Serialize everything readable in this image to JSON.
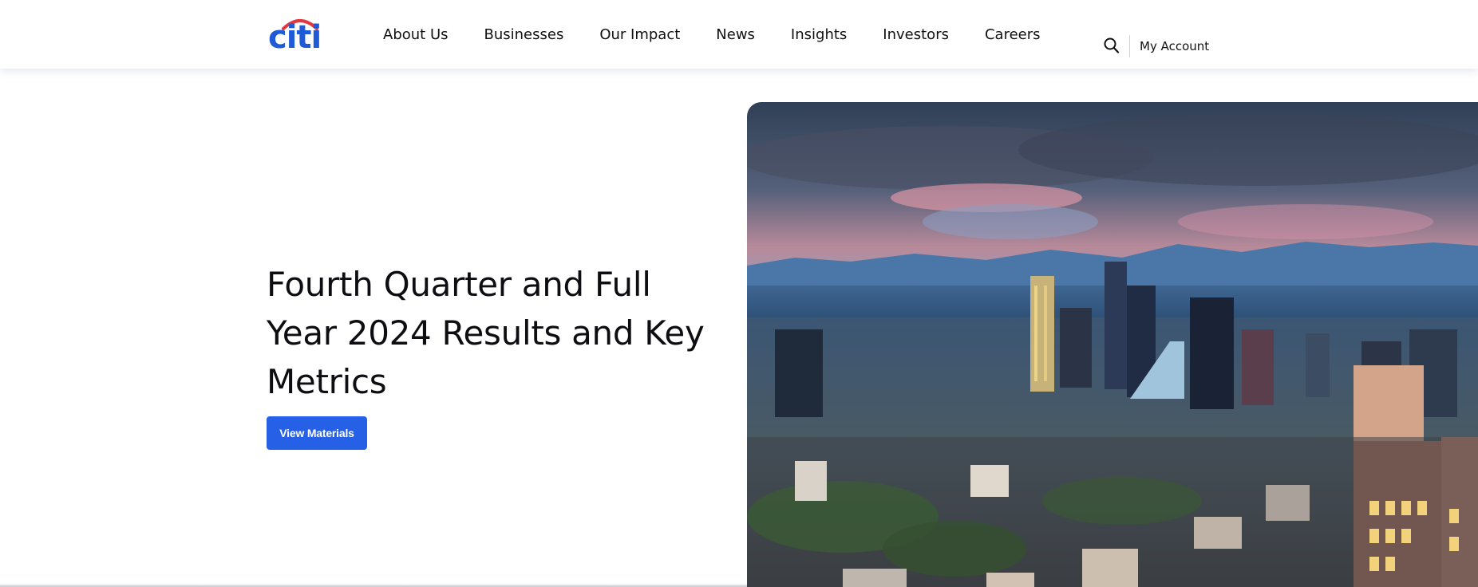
{
  "header": {
    "logo_text": "citi",
    "nav": [
      {
        "label": "About Us"
      },
      {
        "label": "Businesses"
      },
      {
        "label": "Our Impact"
      },
      {
        "label": "News"
      },
      {
        "label": "Insights"
      },
      {
        "label": "Investors"
      },
      {
        "label": "Careers"
      }
    ],
    "search_icon": "search-icon",
    "account_label": "My Account"
  },
  "hero": {
    "title": "Fourth Quarter and Full Year 2024 Results and Key Metrics",
    "cta_label": "View Materials",
    "image": "city-skyline-at-dusk"
  },
  "colors": {
    "brand_blue": "#2560e6",
    "logo_blue": "#1f5bd6",
    "logo_arc_red": "#e0393f",
    "text": "#0f0f14"
  }
}
